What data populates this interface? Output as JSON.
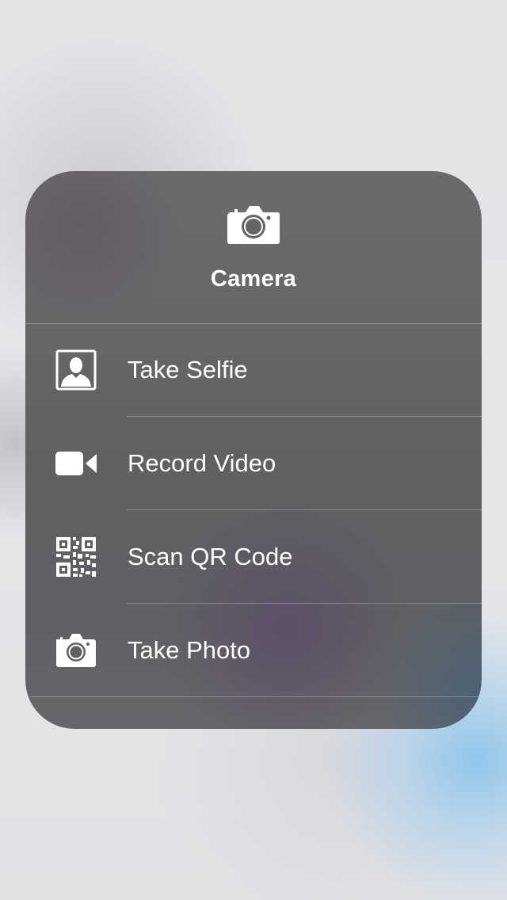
{
  "app": {
    "title": "Camera",
    "icon": "camera-icon"
  },
  "menu": {
    "items": [
      {
        "label": "Take Selfie",
        "icon": "selfie-portrait-icon"
      },
      {
        "label": "Record Video",
        "icon": "video-camera-icon"
      },
      {
        "label": "Scan QR Code",
        "icon": "qr-code-icon"
      },
      {
        "label": "Take Photo",
        "icon": "camera-icon"
      }
    ]
  },
  "colors": {
    "text": "#ffffff",
    "card_background": "#636365",
    "page_background": "#e4e4e8",
    "accent_blur": "#8cc4ec"
  }
}
